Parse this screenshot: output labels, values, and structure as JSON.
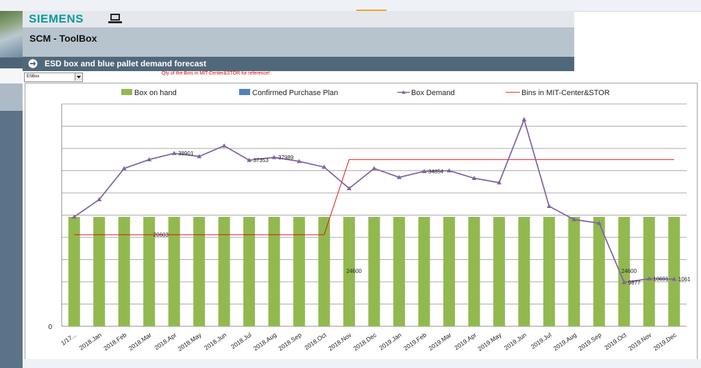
{
  "header": {
    "brand": "SIEMENS",
    "app_title": "SCM - ToolBox",
    "page_title": "ESD box and blue pallet demand forecast"
  },
  "controls": {
    "select_value": "ESBox",
    "note": "Qty of the Bins in MIT-Center&STOR for reference!"
  },
  "colors": {
    "bar": "#92b94f",
    "demand": "#8064a2",
    "bins": "#e01010",
    "confirmed": "#4f81bd"
  },
  "chart_data": {
    "type": "bar",
    "legend": [
      "Box on hand",
      "Confirmed Purchase Plan",
      "Box Demand",
      "Bins in MIT-Center&STOR"
    ],
    "categories": [
      "1/17...",
      "2018.Jan",
      "2018.Feb",
      "2018.Mar",
      "2018.Apr",
      "2018.May",
      "2018.Jun",
      "2018.Jul",
      "2018.Aug",
      "2018.Sep",
      "2018.Oct",
      "2018.Nov",
      "2018.Dec",
      "2019.Jan",
      "2019.Feb",
      "2019.Mar",
      "2019.Apr",
      "2019.May",
      "2019.Jun",
      "2019.Jul",
      "2019.Aug",
      "2019.Sep",
      "2019.Oct",
      "2019.Nov",
      "2019.Dec"
    ],
    "y_tick_labels": [
      "0"
    ],
    "ylim": [
      0,
      50000
    ],
    "series": [
      {
        "name": "Box on hand",
        "type": "bar",
        "values": [
          24600,
          24600,
          24600,
          24600,
          24600,
          24600,
          24600,
          24600,
          24600,
          24600,
          24600,
          24600,
          24600,
          24600,
          24600,
          24600,
          24600,
          24600,
          24600,
          24600,
          24600,
          24600,
          24600,
          24600,
          24600
        ]
      },
      {
        "name": "Box Demand",
        "type": "line",
        "values": [
          24600,
          28500,
          35500,
          37500,
          38901,
          38200,
          40600,
          37353,
          37989,
          37100,
          35800,
          31000,
          35500,
          33500,
          34854,
          35000,
          33300,
          32300,
          46500,
          27000,
          24000,
          23200,
          9877,
          10691,
          10616
        ]
      },
      {
        "name": "Bins in MIT-Center&STOR",
        "type": "line",
        "values": [
          20603,
          20603,
          20603,
          20603,
          20603,
          20603,
          20603,
          20603,
          20603,
          20603,
          20603,
          37500,
          37500,
          37500,
          37500,
          37500,
          37500,
          37500,
          37500,
          37500,
          37500,
          37500,
          37500,
          37500,
          37500
        ]
      }
    ],
    "data_labels": [
      {
        "series": "Box Demand",
        "index": 4,
        "text": "38901"
      },
      {
        "series": "Box Demand",
        "index": 7,
        "text": "37353"
      },
      {
        "series": "Box Demand",
        "index": 8,
        "text": "37989"
      },
      {
        "series": "Box Demand",
        "index": 14,
        "text": "34854"
      },
      {
        "series": "Box Demand",
        "index": 22,
        "text": "9877"
      },
      {
        "series": "Box Demand",
        "index": 23,
        "text": "10691"
      },
      {
        "series": "Box Demand",
        "index": 24,
        "text": "1061"
      },
      {
        "series": "Bins in MIT-Center&STOR",
        "index": 3,
        "text": "20603"
      },
      {
        "series": "Box on hand",
        "index": 11,
        "text": "24600"
      },
      {
        "series": "Box on hand",
        "index": 22,
        "text": "24600"
      }
    ]
  }
}
